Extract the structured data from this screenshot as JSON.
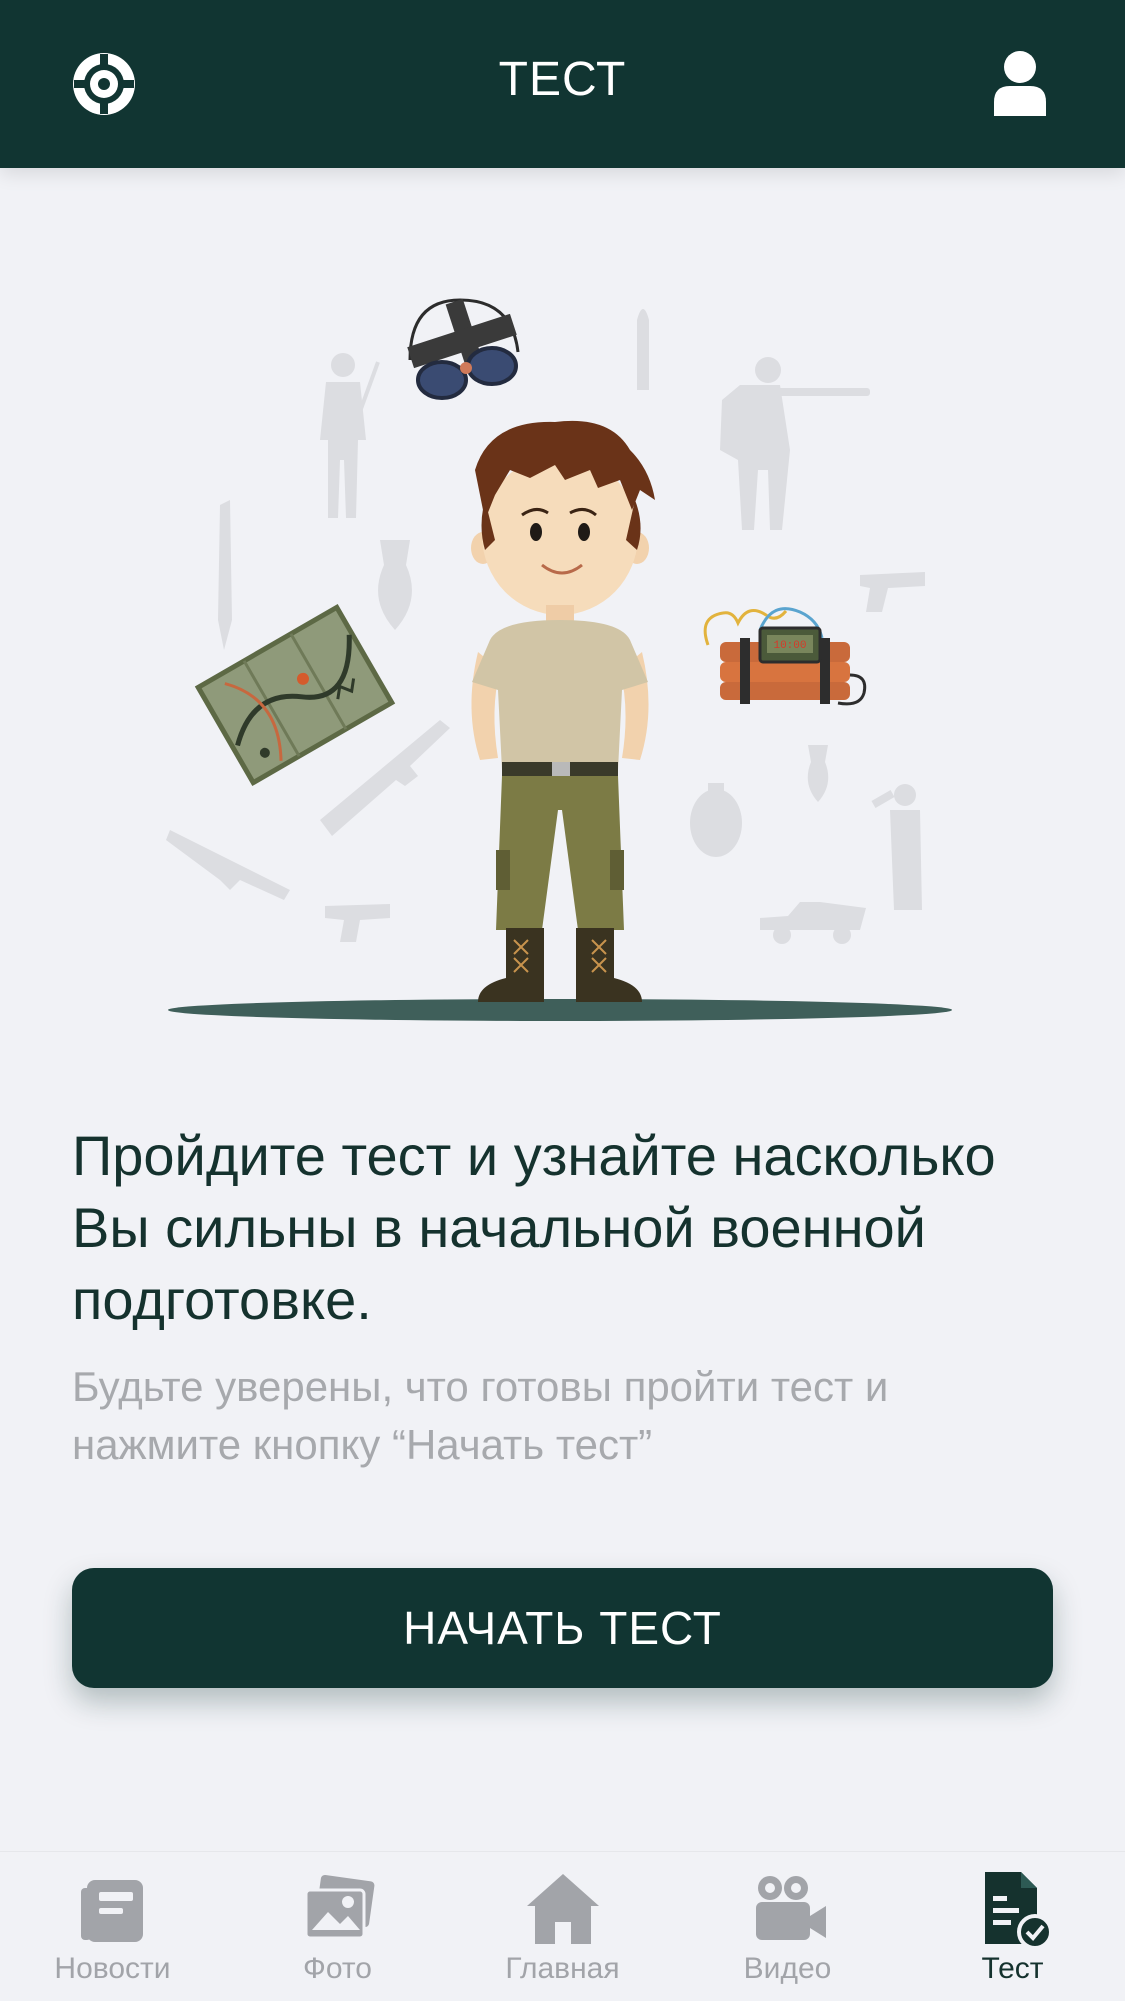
{
  "header": {
    "title": "ТЕСТ",
    "left_icon": "crosshair-icon",
    "right_icon": "user-icon"
  },
  "main": {
    "headline": "Пройдите тест и узнайте насколько  Вы сильны в начальной военной подготовке.",
    "subtext": "Будьте уверены, что готовы пройти тест и нажмите кнопку “Начать тест”",
    "cta_label": "НАЧАТЬ ТЕСТ"
  },
  "illustration": {
    "timer_text": "10:00",
    "shown": [
      "soldier-character",
      "binoculars",
      "map",
      "dynamite-timer",
      "weapon-silhouettes"
    ]
  },
  "tabbar": {
    "items": [
      {
        "label": "Новости",
        "icon": "news-icon"
      },
      {
        "label": "Фото",
        "icon": "photo-icon"
      },
      {
        "label": "Главная",
        "icon": "home-icon"
      },
      {
        "label": "Видео",
        "icon": "video-icon"
      },
      {
        "label": "Тест",
        "icon": "test-icon",
        "active": true
      }
    ]
  },
  "colors": {
    "primary": "#113532",
    "background": "#f1f2f6",
    "muted_text": "#a7a9ad",
    "inactive_tab": "#a2a4a9"
  }
}
